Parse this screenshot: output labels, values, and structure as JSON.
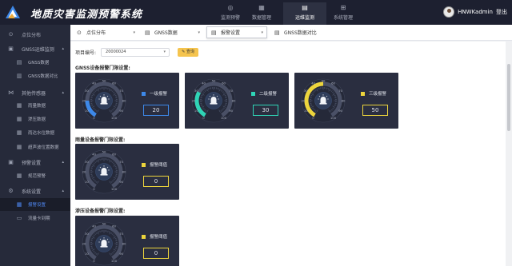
{
  "app": {
    "title": "地质灾害监测预警系统"
  },
  "nav": [
    {
      "label": "监测预警",
      "icon": "◎"
    },
    {
      "label": "数据管理",
      "icon": "▦"
    },
    {
      "label": "运维监测",
      "icon": "▤"
    },
    {
      "label": "系统管理",
      "icon": "⊞"
    }
  ],
  "user": {
    "name": "HNWKadmin",
    "logout": "登出"
  },
  "sidebar": {
    "items": [
      {
        "label": "点位分布",
        "icon": "⊙"
      },
      {
        "label": "GNSS运维监测",
        "icon": "▣",
        "caret": "▴"
      },
      {
        "label": "GNSS数据",
        "icon": "▤"
      },
      {
        "label": "GNSS数据对比",
        "icon": "▥"
      },
      {
        "label": "其他传感器",
        "icon": "⋈",
        "caret": "▴"
      },
      {
        "label": "雨量数据",
        "icon": "▦"
      },
      {
        "label": "渗压数据",
        "icon": "▦"
      },
      {
        "label": "雨达水位数据",
        "icon": "▦"
      },
      {
        "label": "超声波位置数据",
        "icon": "▦"
      },
      {
        "label": "预警设置",
        "icon": "▣",
        "caret": "▴"
      },
      {
        "label": "规范预警",
        "icon": "▦"
      },
      {
        "label": "系统设置",
        "icon": "⚙",
        "caret": "▴"
      },
      {
        "label": "报警设置",
        "icon": "▦"
      },
      {
        "label": "流量卡到期",
        "icon": "▭"
      }
    ]
  },
  "tabs": [
    {
      "label": "点位分布",
      "icon": "⊙"
    },
    {
      "label": "GNSS数据",
      "icon": "▤"
    },
    {
      "label": "报警设置",
      "icon": "▤"
    },
    {
      "label": "GNSS数据对比",
      "icon": "▤"
    }
  ],
  "project": {
    "label": "项目编号:",
    "value": "20000024",
    "query": "查询"
  },
  "sections": {
    "gnss": "GNSS设备报警门限设置:",
    "rain": "雨量设备报警门限设置:",
    "seep": "渗压设备报警门限设置:"
  },
  "gauge": {
    "ticks": [
      "0",
      "10",
      "20",
      "30",
      "40",
      "50",
      "60",
      "70",
      "80",
      "90",
      "100"
    ],
    "max": 100
  },
  "cards": [
    {
      "label": "一级报警",
      "value": "20",
      "level": 20,
      "color": "#3d88e8"
    },
    {
      "label": "二级报警",
      "value": "30",
      "level": 30,
      "color": "#2fd4b6"
    },
    {
      "label": "三级报警",
      "value": "50",
      "level": 50,
      "color": "#ecd43c"
    },
    {
      "label": "报警阈值",
      "value": "0",
      "level": 0,
      "color": "#ecd43c"
    },
    {
      "label": "报警阈值",
      "value": "0",
      "level": 0,
      "color": "#ecd43c"
    }
  ],
  "colors": {
    "topbar": "#1d2030",
    "sidebar": "#262a3a",
    "selected": "#4e86ee",
    "card": "#2a2e40"
  }
}
